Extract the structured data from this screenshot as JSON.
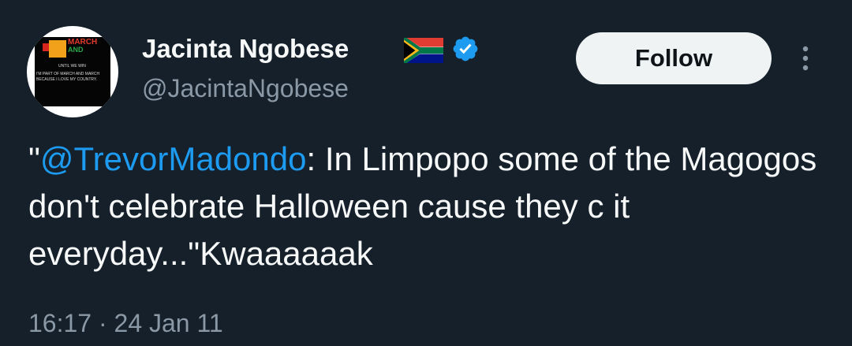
{
  "author": {
    "display_name": "Jacinta Ngobese",
    "handle": "@JacintaNgobese",
    "verified": true,
    "flag_icon": "south-africa-flag-icon",
    "avatar": {
      "title_line1": "MARCH",
      "title_line2": "AND",
      "subtitle": "UNTIL WE WIN",
      "line1": "I'M PART OF MARCH AND MARCH",
      "line2": "BECAUSE I LOVE MY COUNTRY."
    }
  },
  "actions": {
    "follow_label": "Follow",
    "more_icon": "more-vertical-icon"
  },
  "tweet": {
    "open_quote": "\"",
    "mention": "@TrevorMadondo",
    "text_after_mention": ": In Limpopo some of the Magogos don't celebrate Halloween cause they c it everyday...\"Kwaaaaaak"
  },
  "meta": {
    "timestamp": "16:17 · 24 Jan 11"
  },
  "colors": {
    "background": "#15202b",
    "text": "#f7f9f9",
    "secondary_text": "#8b98a5",
    "link": "#1d9bf0",
    "verified_badge": "#1d9bf0",
    "follow_button_bg": "#eff3f4"
  }
}
